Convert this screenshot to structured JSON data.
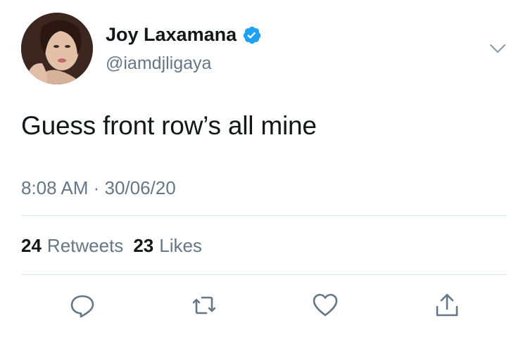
{
  "tweet": {
    "author": {
      "display_name": "Joy Laxamana",
      "handle": "@iamdjligaya",
      "verified": true,
      "avatar_icon": "profile-photo"
    },
    "text": "Guess front row’s all mine",
    "timestamp": "8:08 AM · 30/06/20",
    "stats": {
      "retweets_count": "24",
      "retweets_label": "Retweets",
      "likes_count": "23",
      "likes_label": "Likes"
    },
    "actions": [
      "reply-icon",
      "retweet-icon",
      "like-icon",
      "share-icon"
    ]
  },
  "colors": {
    "primary_text": "#14171a",
    "secondary_text": "#657786",
    "verified_blue": "#1da1f2",
    "divider": "#e1e8ed"
  }
}
